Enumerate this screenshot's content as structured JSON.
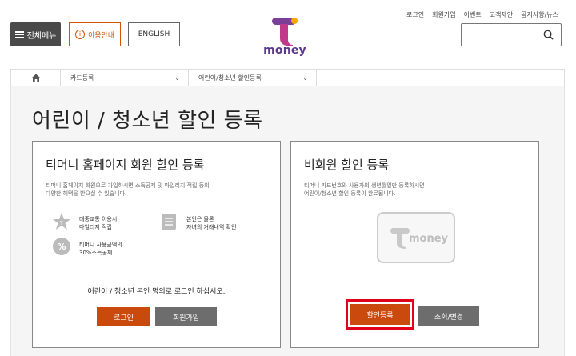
{
  "header": {
    "menu_label": "전체메뉴",
    "guide_label": "이용안내",
    "english_label": "ENGLISH",
    "logo_word": "money",
    "topnav": [
      "로그인",
      "회원가입",
      "이벤트",
      "고객제안",
      "공지사항/뉴스"
    ],
    "search": {
      "value": "",
      "placeholder": ""
    }
  },
  "breadcrumb": {
    "items": [
      "카드등록",
      "어린이/청소년 할인등록"
    ]
  },
  "page": {
    "title": "어린이 / 청소년 할인 등록"
  },
  "member_card": {
    "heading": "티머니 홈페이지 회원 할인 등록",
    "desc_line1": "티머니 홈페이지 회원으로 가입하시면 소득공제 및 마일리지 적립 등의",
    "desc_line2": "다양한 혜택을 받으실 수 있습니다.",
    "benefit1_line1": "대중교통 이용시",
    "benefit1_line2": "마일리지 적립",
    "benefit2_line1": "본인은 물론",
    "benefit2_line2": "자녀의 거래내역 확인",
    "benefit3_line1": "티머니 사용금액의",
    "benefit3_line2": "30%소득공제",
    "notice": "어린이 / 청소년 본인 명의로 로그인 하십시오.",
    "login_label": "로그인",
    "join_label": "회원가입"
  },
  "nonmember_card": {
    "heading": "비회원 할인 등록",
    "desc_line1": "티머니 카드번호와 사용자의 생년월일만 등록하시면",
    "desc_line2": "어린이/청소년 할인 등록이 완료됩니다.",
    "card_logo_word": "money",
    "register_label": "할인등록",
    "inquiry_label": "조회/변경"
  },
  "colors": {
    "accent": "#c94a0c",
    "gray_button": "#6d6d6d",
    "highlight": "#e0001b",
    "logo_purple": "#5b3a8c",
    "logo_orange": "#f7a600"
  },
  "icons": [
    "hamburger-icon",
    "info-icon",
    "search-icon",
    "home-icon",
    "chevron-down-icon",
    "star-icon",
    "receipt-icon",
    "percent-icon"
  ]
}
